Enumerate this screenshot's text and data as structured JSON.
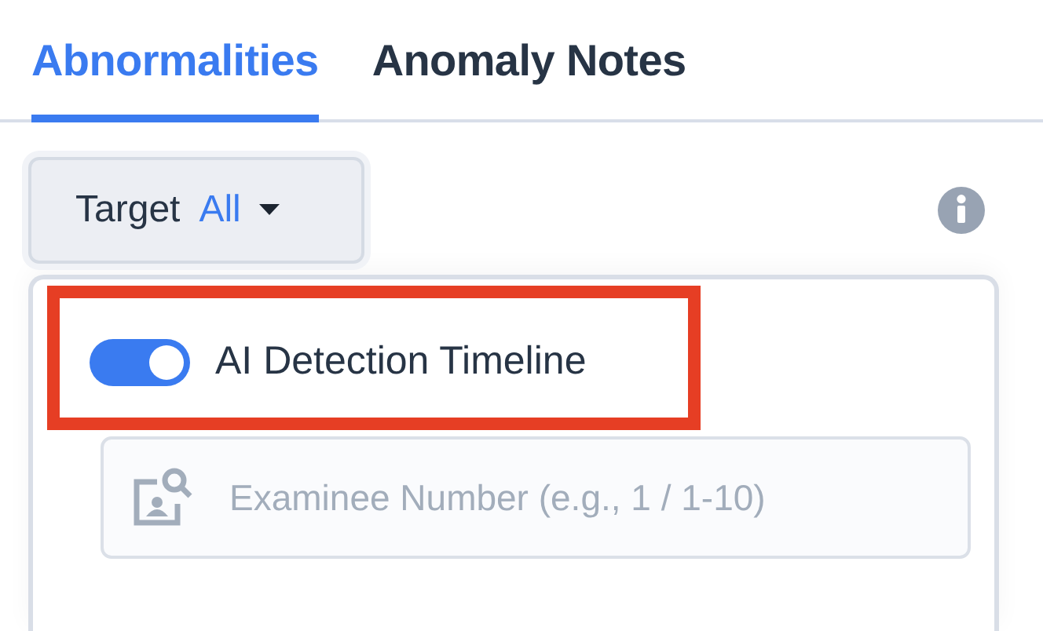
{
  "tabs": [
    {
      "label": "Abnormalities",
      "selected": true
    },
    {
      "label": "Anomaly Notes",
      "selected": false
    }
  ],
  "filter": {
    "label": "Target",
    "value": "All"
  },
  "panel": {
    "toggle": {
      "label": "AI Detection Timeline",
      "on": true,
      "highlighted": true
    },
    "search": {
      "placeholder": "Examinee Number (e.g., 1 / 1-10)"
    }
  }
}
